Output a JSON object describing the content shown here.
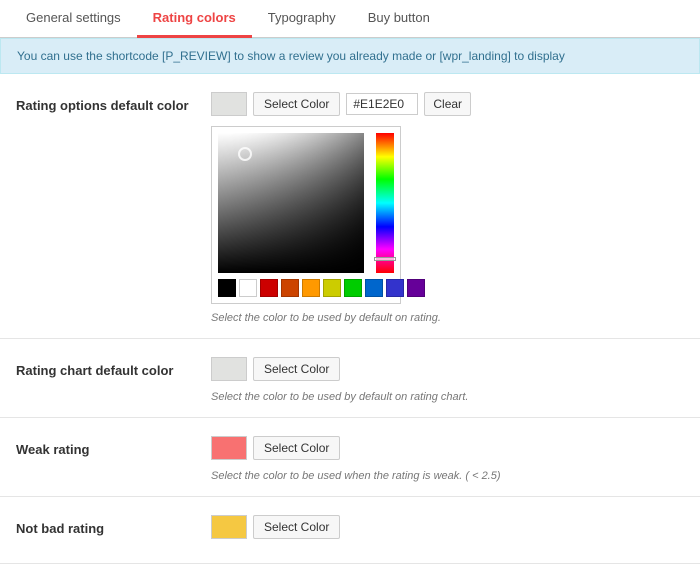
{
  "tabs": [
    {
      "id": "general",
      "label": "General settings",
      "active": false
    },
    {
      "id": "rating-colors",
      "label": "Rating colors",
      "active": true
    },
    {
      "id": "typography",
      "label": "Typography",
      "active": false
    },
    {
      "id": "buy-button",
      "label": "Buy button",
      "active": false
    }
  ],
  "infoBanner": {
    "text": "You can use the shortcode [P_REVIEW] to show a review you already made or [wpr_landing] to display"
  },
  "settings": [
    {
      "id": "rating-options-default-color",
      "label": "Rating options default color",
      "hasColorPicker": true,
      "colorHex": "#E1E2E0",
      "swatchColor": "#e1e2e0",
      "hintText": "Select the color to be used by default on rating.",
      "swatches": [
        "#000000",
        "#ffffff",
        "#cc0000",
        "#cc4400",
        "#ff9900",
        "#cccc00",
        "#00cc00",
        "#0066cc",
        "#3333cc",
        "#660099"
      ]
    },
    {
      "id": "rating-chart-default-color",
      "label": "Rating chart default color",
      "hasColorPicker": false,
      "colorHex": "",
      "swatchColor": "#e1e2e0",
      "hintText": "Select the color to be used by default on rating chart.",
      "swatches": []
    },
    {
      "id": "weak-rating",
      "label": "Weak rating",
      "hasColorPicker": false,
      "colorHex": "",
      "swatchColor": "#f87171",
      "hintText": "Select the color to be used when the rating is weak. ( < 2.5)",
      "swatches": []
    },
    {
      "id": "not-bad-rating",
      "label": "Not bad rating",
      "hasColorPicker": false,
      "colorHex": "",
      "swatchColor": "#f5c842",
      "hintText": "",
      "swatches": []
    }
  ],
  "buttons": {
    "selectColor": "Select Color",
    "clear": "Clear"
  }
}
